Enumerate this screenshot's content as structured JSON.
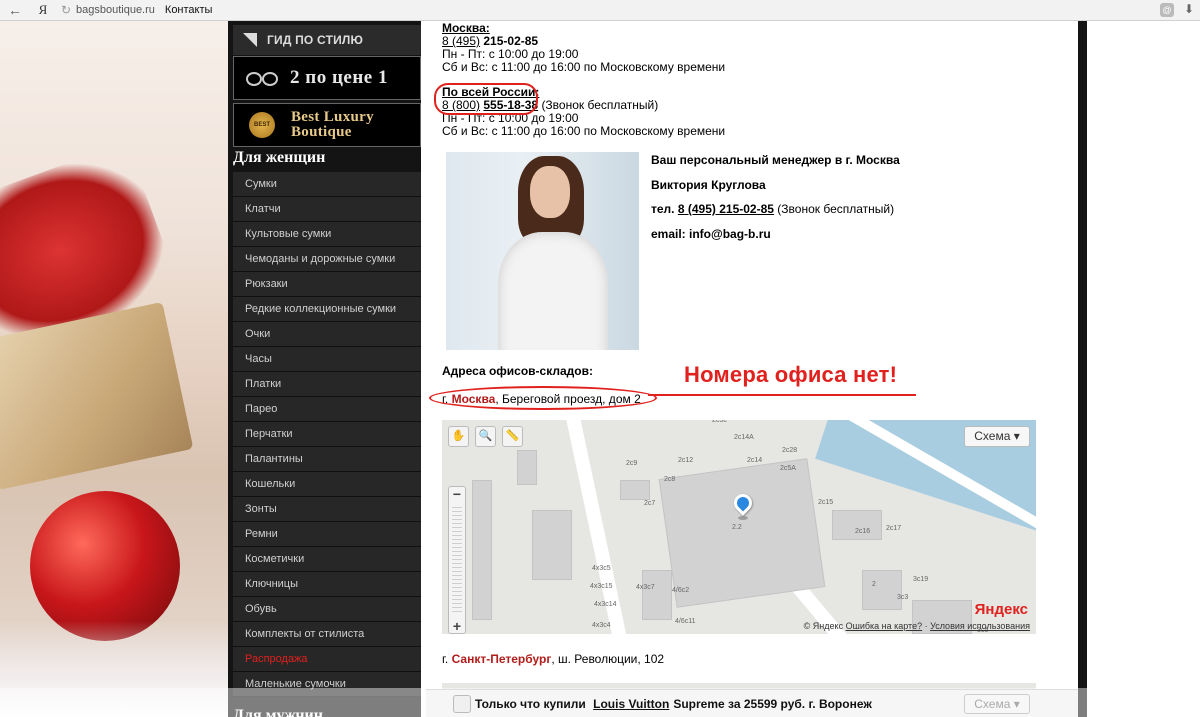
{
  "browser": {
    "back_icon": "←",
    "yandex_icon": "Я",
    "reload_icon": "↻",
    "domain": "bagsboutique.ru",
    "title": "Контакты",
    "download_icon": "⬇"
  },
  "sidebar": {
    "guide_label": "ГИД ПО СТИЛЮ",
    "banner1": "2 по цене 1",
    "banner2_seal": "BEST",
    "banner2_line1": "Best Luxury",
    "banner2_line2": "Boutique",
    "women_heading": "Для женщин",
    "items": [
      {
        "label": "Сумки"
      },
      {
        "label": "Клатчи"
      },
      {
        "label": "Культовые сумки"
      },
      {
        "label": "Чемоданы и дорожные сумки"
      },
      {
        "label": "Рюкзаки"
      },
      {
        "label": "Редкие коллекционные сумки"
      },
      {
        "label": "Очки"
      },
      {
        "label": "Часы"
      },
      {
        "label": "Платки"
      },
      {
        "label": "Парео"
      },
      {
        "label": "Перчатки"
      },
      {
        "label": "Палантины"
      },
      {
        "label": "Кошельки"
      },
      {
        "label": "Зонты"
      },
      {
        "label": "Ремни"
      },
      {
        "label": "Косметички"
      },
      {
        "label": "Ключницы"
      },
      {
        "label": "Обувь"
      },
      {
        "label": "Комплекты от стилиста"
      },
      {
        "label": "Распродажа"
      },
      {
        "label": "Маленькие сумочки"
      }
    ],
    "men_heading": "Для мужчин"
  },
  "contacts": {
    "moscow": {
      "city": "Москва:",
      "phone_code": "8 (495)",
      "phone_number": "215-02-85",
      "hours_weekdays": "Пн - Пт: с 10:00 до 19:00",
      "hours_weekend": "Сб и Вс: с 11:00 до 16:00 по Московскому времени"
    },
    "russia": {
      "city": "По всей России:",
      "phone_code": "8 (800)",
      "phone_number": "555-18-38",
      "phone_note": "(Звонок бесплатный)",
      "hours_weekdays": "Пн - Пт: с 10:00 до 19:00",
      "hours_weekend": "Сб и Вс: с 11:00 до 16:00 по Московскому времени"
    }
  },
  "manager": {
    "title": "Ваш персональный менеджер в г. Москва",
    "name": "Виктория Круглова",
    "phone_label": "тел.",
    "phone": "8 (495) 215-02-85",
    "phone_note": "(Звонок бесплатный)",
    "email": "email: info@bag-b.ru"
  },
  "offices": {
    "heading": "Адреса офисов-складов:",
    "annotation": "Номера офиса нет!",
    "moscow_prefix": "г.",
    "moscow_city": "Москва",
    "moscow_address": ", Береговой проезд, дом 2",
    "spb_prefix": "г.",
    "spb_city": "Санкт-Петербург",
    "spb_address": ", ш. Революции, 102"
  },
  "map": {
    "hand_icon": "✋",
    "magnifier_icon": "🔍",
    "ruler_icon": "📏",
    "scheme_label": "Схема ▾",
    "zoom_minus": "−",
    "zoom_plus": "+",
    "logo": "Яндекс",
    "copyright": "© Яндекс",
    "error_link": "Ошибка на карте?",
    "terms_link": "Условия использования",
    "labels": [
      "2c9",
      "2c12",
      "2c14A",
      "2c14",
      "2c28",
      "2c5A",
      "2c8",
      "2c7",
      "2c15",
      "2c16",
      "2c17",
      "2.2",
      "4x3c5",
      "4x3c15",
      "4x3c7",
      "4/6c2",
      "4x3c14",
      "4/6c11",
      "4x3c4",
      "3c19",
      "3c3",
      "3c5",
      "2c3c",
      "2"
    ]
  },
  "notification": {
    "text_before": "Только что купили",
    "link": "Louis Vuitton",
    "text_after": "Supreme за 25599 руб. г. Воронеж",
    "scheme_label": "Схема ▾"
  }
}
